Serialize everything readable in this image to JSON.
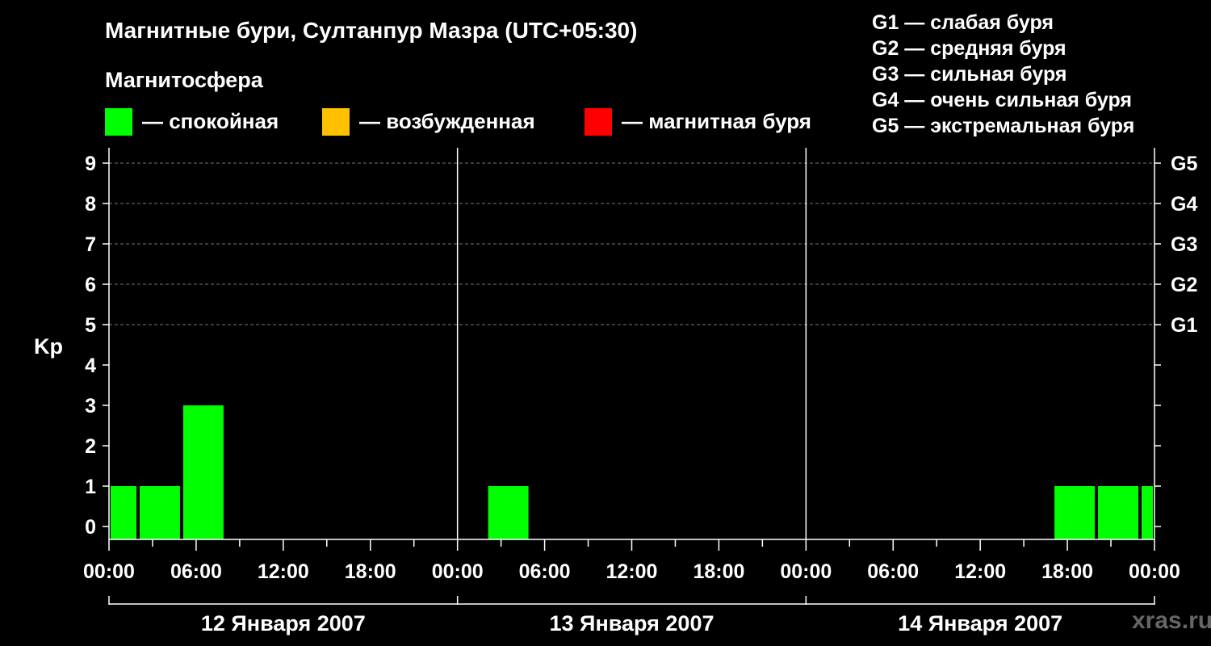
{
  "title": "Магнитные бури, Султанпур Мазра (UTC+05:30)",
  "subtitle": "Магнитосфера",
  "legend": [
    {
      "color": "#00ff00",
      "label": "— спокойная"
    },
    {
      "color": "#ffc000",
      "label": "— возбужденная"
    },
    {
      "color": "#ff0000",
      "label": "— магнитная буря"
    }
  ],
  "scale": [
    "G1 — слабая буря",
    "G2 — средняя буря",
    "G3 — сильная буря",
    "G4 — очень сильная буря",
    "G5 — экстремальная буря"
  ],
  "watermark": "xras.ru",
  "chart_data": {
    "type": "bar",
    "ylabel": "Kp",
    "ylim": [
      0,
      9
    ],
    "yticks": [
      "0",
      "1",
      "2",
      "3",
      "4",
      "5",
      "6",
      "7",
      "8",
      "9"
    ],
    "right_ticks": [
      {
        "value": 5,
        "label": "G1"
      },
      {
        "value": 6,
        "label": "G2"
      },
      {
        "value": 7,
        "label": "G3"
      },
      {
        "value": 8,
        "label": "G4"
      },
      {
        "value": 9,
        "label": "G5"
      }
    ],
    "xlim_hours": [
      0,
      72
    ],
    "xticks": [
      "00:00",
      "06:00",
      "12:00",
      "18:00",
      "00:00",
      "06:00",
      "12:00",
      "18:00",
      "00:00",
      "06:00",
      "12:00",
      "18:00",
      "00:00"
    ],
    "days": [
      "12 Января 2007",
      "13 Января 2007",
      "14 Января 2007"
    ],
    "bars": [
      {
        "start_hour": 0,
        "end_hour": 2,
        "kp": 1,
        "color": "#00ff00"
      },
      {
        "start_hour": 2,
        "end_hour": 5,
        "kp": 1,
        "color": "#00ff00"
      },
      {
        "start_hour": 5,
        "end_hour": 8,
        "kp": 3,
        "color": "#00ff00"
      },
      {
        "start_hour": 26,
        "end_hour": 29,
        "kp": 1,
        "color": "#00ff00"
      },
      {
        "start_hour": 65,
        "end_hour": 68,
        "kp": 1,
        "color": "#00ff00"
      },
      {
        "start_hour": 68,
        "end_hour": 71,
        "kp": 1,
        "color": "#00ff00"
      },
      {
        "start_hour": 71,
        "end_hour": 72,
        "kp": 1,
        "color": "#00ff00"
      }
    ]
  }
}
